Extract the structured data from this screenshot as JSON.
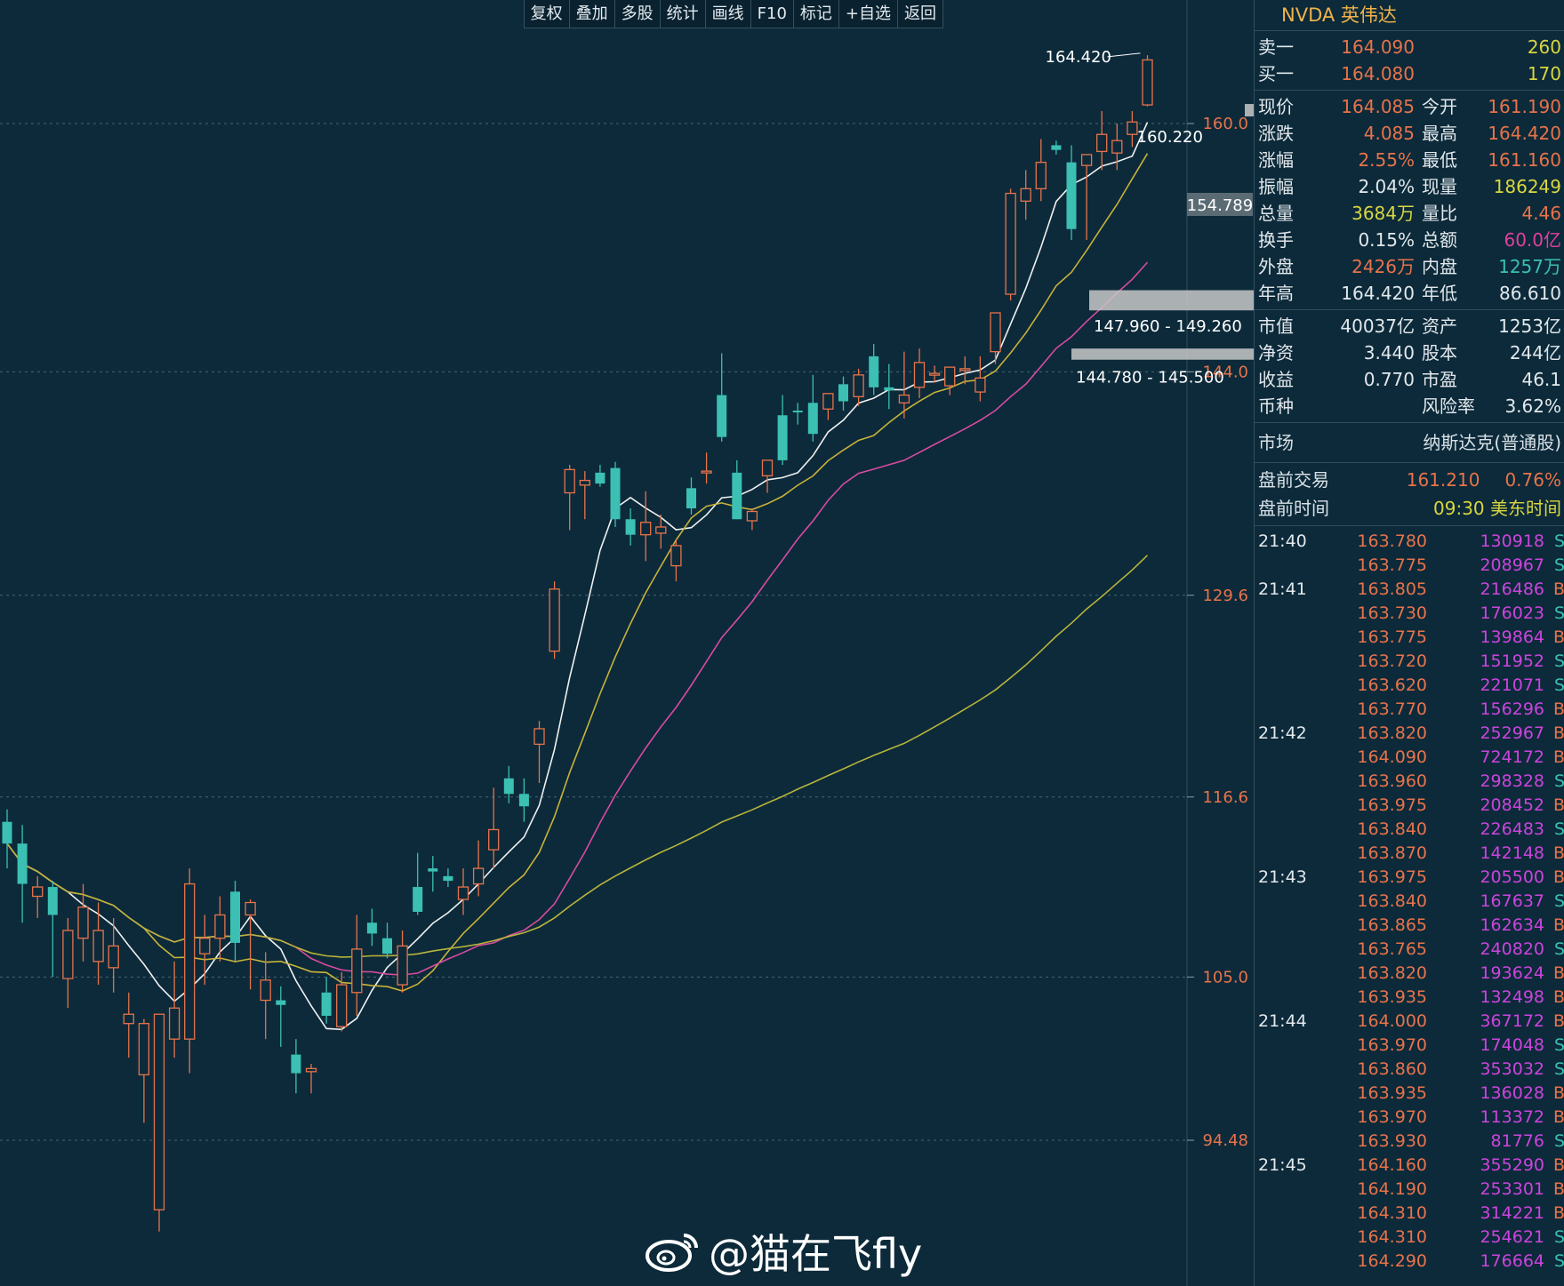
{
  "toolbar": [
    "复权",
    "叠加",
    "多股",
    "统计",
    "画线",
    "F10",
    "标记",
    "+自选",
    "返回"
  ],
  "chart": {
    "price_axis": [
      "160.0",
      "144.0",
      "129.6",
      "116.6",
      "105.0",
      "94.48"
    ],
    "current_tag": "154.789",
    "high_label": "164.420",
    "last_label": "160.220",
    "zone_upper_label": "147.960 - 149.260",
    "zone_lower_label": "144.780 - 145.500"
  },
  "quote": {
    "title": "NVDA 英伟达",
    "book": [
      {
        "label": "卖一",
        "price": "164.090",
        "vol": "260"
      },
      {
        "label": "买一",
        "price": "164.080",
        "vol": "170"
      }
    ],
    "stats": [
      {
        "l1": "现价",
        "v1": "164.085",
        "c1": "red",
        "l2": "今开",
        "v2": "161.190",
        "c2": "red"
      },
      {
        "l1": "涨跌",
        "v1": "4.085",
        "c1": "red",
        "l2": "最高",
        "v2": "164.420",
        "c2": "red"
      },
      {
        "l1": "涨幅",
        "v1": "2.55%",
        "c1": "red",
        "l2": "最低",
        "v2": "161.160",
        "c2": "red"
      },
      {
        "l1": "振幅",
        "v1": "2.04%",
        "c1": "wht",
        "l2": "现量",
        "v2": "186249",
        "c2": "yel"
      },
      {
        "l1": "总量",
        "v1": "3684万",
        "c1": "yel",
        "l2": "量比",
        "v2": "4.46",
        "c2": "red"
      },
      {
        "l1": "换手",
        "v1": "0.15%",
        "c1": "wht",
        "l2": "总额",
        "v2": "60.0亿",
        "c2": "mag"
      },
      {
        "l1": "外盘",
        "v1": "2426万",
        "c1": "red",
        "l2": "内盘",
        "v2": "1257万",
        "c2": "teal"
      },
      {
        "l1": "年高",
        "v1": "164.420",
        "c1": "wht",
        "l2": "年低",
        "v2": "86.610",
        "c2": "wht"
      }
    ],
    "fundamentals": [
      {
        "l1": "市值",
        "v1": "40037亿",
        "l2": "资产",
        "v2": "1253亿"
      },
      {
        "l1": "净资",
        "v1": "3.440",
        "l2": "股本",
        "v2": "244亿"
      },
      {
        "l1": "收益",
        "v1": "0.770",
        "l2": "市盈",
        "v2": "46.1"
      },
      {
        "l1": "币种",
        "v1": "",
        "l2": "风险率",
        "v2": "3.62%"
      }
    ],
    "market_label": "市场",
    "market_value": "纳斯达克(普通股)",
    "premarket_label": "盘前交易",
    "premarket_price": "161.210",
    "premarket_pct": "0.76%",
    "pretime_label": "盘前时间",
    "pretime_value": "09:30 美东时间"
  },
  "ticks": [
    {
      "t": "21:40",
      "p": "163.780",
      "v": "130918",
      "s": "S"
    },
    {
      "t": "",
      "p": "163.775",
      "v": "208967",
      "s": "S"
    },
    {
      "t": "21:41",
      "p": "163.805",
      "v": "216486",
      "s": "B"
    },
    {
      "t": "",
      "p": "163.730",
      "v": "176023",
      "s": "S"
    },
    {
      "t": "",
      "p": "163.775",
      "v": "139864",
      "s": "B"
    },
    {
      "t": "",
      "p": "163.720",
      "v": "151952",
      "s": "S"
    },
    {
      "t": "",
      "p": "163.620",
      "v": "221071",
      "s": "S"
    },
    {
      "t": "",
      "p": "163.770",
      "v": "156296",
      "s": "B"
    },
    {
      "t": "21:42",
      "p": "163.820",
      "v": "252967",
      "s": "B"
    },
    {
      "t": "",
      "p": "164.090",
      "v": "724172",
      "s": "B"
    },
    {
      "t": "",
      "p": "163.960",
      "v": "298328",
      "s": "S"
    },
    {
      "t": "",
      "p": "163.975",
      "v": "208452",
      "s": "B"
    },
    {
      "t": "",
      "p": "163.840",
      "v": "226483",
      "s": "S"
    },
    {
      "t": "",
      "p": "163.870",
      "v": "142148",
      "s": "B"
    },
    {
      "t": "21:43",
      "p": "163.975",
      "v": "205500",
      "s": "B"
    },
    {
      "t": "",
      "p": "163.840",
      "v": "167637",
      "s": "S"
    },
    {
      "t": "",
      "p": "163.865",
      "v": "162634",
      "s": "B"
    },
    {
      "t": "",
      "p": "163.765",
      "v": "240820",
      "s": "S"
    },
    {
      "t": "",
      "p": "163.820",
      "v": "193624",
      "s": "B"
    },
    {
      "t": "",
      "p": "163.935",
      "v": "132498",
      "s": "B"
    },
    {
      "t": "21:44",
      "p": "164.000",
      "v": "367172",
      "s": "B"
    },
    {
      "t": "",
      "p": "163.970",
      "v": "174048",
      "s": "S"
    },
    {
      "t": "",
      "p": "163.860",
      "v": "353032",
      "s": "S"
    },
    {
      "t": "",
      "p": "163.935",
      "v": "136028",
      "s": "B"
    },
    {
      "t": "",
      "p": "163.970",
      "v": "113372",
      "s": "B"
    },
    {
      "t": "",
      "p": "163.930",
      "v": "81776",
      "s": "S"
    },
    {
      "t": "21:45",
      "p": "164.160",
      "v": "355290",
      "s": "B"
    },
    {
      "t": "",
      "p": "164.190",
      "v": "253301",
      "s": "B"
    },
    {
      "t": "",
      "p": "164.310",
      "v": "314221",
      "s": "B"
    },
    {
      "t": "",
      "p": "164.310",
      "v": "254621",
      "s": "S"
    },
    {
      "t": "",
      "p": "164.290",
      "v": "176664",
      "s": "S"
    }
  ],
  "watermark": "@猫在飞fly",
  "colors": {
    "up": "#e8734a",
    "down": "#3bc0b3",
    "bg": "#0c2a3a"
  },
  "chart_data": {
    "type": "candlestick",
    "y_ticks": [
      160.0,
      144.0,
      129.6,
      116.6,
      105.0,
      94.48
    ],
    "candles": [
      [
        115.0,
        115.8,
        112.0,
        113.6
      ],
      [
        113.6,
        114.8,
        108.5,
        111.0
      ],
      [
        110.2,
        111.5,
        108.8,
        110.8
      ],
      [
        110.8,
        111.2,
        105.0,
        109.0
      ],
      [
        104.9,
        108.8,
        103.0,
        108.0
      ],
      [
        107.5,
        111.0,
        106.0,
        109.5
      ],
      [
        106.0,
        109.8,
        104.5,
        108.0
      ],
      [
        105.6,
        108.8,
        104.0,
        107.0
      ],
      [
        102.0,
        104.0,
        99.8,
        102.6
      ],
      [
        98.7,
        102.3,
        95.6,
        102.0
      ],
      [
        90.0,
        102.6,
        88.6,
        102.6
      ],
      [
        101.0,
        106.0,
        99.8,
        103.0
      ],
      [
        101.0,
        112.0,
        98.8,
        111.0
      ],
      [
        106.5,
        109.0,
        104.5,
        107.5
      ],
      [
        107.5,
        110.2,
        106.0,
        109.0
      ],
      [
        110.5,
        111.2,
        106.0,
        107.2
      ],
      [
        109.0,
        110.0,
        104.2,
        109.8
      ],
      [
        103.5,
        106.6,
        101.0,
        104.8
      ],
      [
        103.5,
        104.4,
        100.5,
        103.2
      ],
      [
        100.0,
        101.0,
        97.5,
        98.8
      ],
      [
        98.9,
        99.4,
        97.5,
        99.1
      ],
      [
        104.0,
        105.0,
        102.0,
        102.5
      ],
      [
        101.8,
        105.3,
        101.5,
        104.5
      ],
      [
        104.0,
        109.0,
        102.5,
        106.8
      ],
      [
        108.5,
        109.4,
        107.0,
        107.8
      ],
      [
        107.5,
        108.5,
        106.2,
        106.5
      ],
      [
        104.5,
        108.0,
        104.0,
        107.0
      ],
      [
        110.8,
        113.0,
        109.0,
        109.2
      ],
      [
        112.0,
        112.8,
        110.5,
        111.8
      ],
      [
        111.5,
        112.0,
        110.8,
        111.2
      ],
      [
        110.0,
        112.0,
        109.0,
        110.8
      ],
      [
        111.0,
        113.8,
        110.2,
        112.0
      ],
      [
        113.2,
        117.2,
        112.0,
        114.5
      ],
      [
        117.8,
        118.6,
        116.2,
        116.8
      ],
      [
        116.8,
        117.8,
        115.0,
        116.0
      ],
      [
        120.0,
        121.5,
        117.5,
        121.0
      ],
      [
        126.0,
        130.5,
        125.5,
        130.0
      ],
      [
        136.2,
        138.0,
        133.8,
        137.7
      ],
      [
        136.7,
        137.6,
        134.5,
        137.0
      ],
      [
        137.5,
        138.0,
        136.6,
        136.8
      ],
      [
        137.8,
        138.2,
        134.0,
        134.5
      ],
      [
        134.5,
        135.2,
        132.8,
        133.5
      ],
      [
        133.5,
        136.3,
        131.8,
        134.3
      ],
      [
        133.6,
        134.8,
        132.6,
        134.0
      ],
      [
        131.5,
        133.2,
        130.5,
        132.8
      ],
      [
        136.5,
        137.2,
        134.8,
        135.2
      ],
      [
        137.5,
        138.8,
        136.8,
        137.6
      ],
      [
        142.5,
        145.2,
        139.5,
        139.8
      ],
      [
        137.5,
        138.3,
        134.5,
        134.5
      ],
      [
        134.4,
        135.2,
        133.8,
        135.0
      ],
      [
        137.3,
        138.3,
        136.2,
        138.3
      ],
      [
        141.2,
        142.5,
        138.0,
        138.3
      ],
      [
        141.5,
        142.0,
        140.6,
        141.4
      ],
      [
        142.0,
        143.8,
        139.5,
        140.0
      ],
      [
        141.6,
        142.5,
        140.9,
        142.6
      ],
      [
        143.2,
        143.7,
        141.5,
        142.1
      ],
      [
        142.4,
        144.2,
        141.8,
        143.8
      ],
      [
        145.0,
        145.8,
        142.5,
        143.0
      ],
      [
        143.0,
        144.5,
        141.6,
        142.8
      ],
      [
        142.0,
        145.3,
        141.0,
        142.5
      ],
      [
        143.0,
        145.5,
        142.3,
        144.6
      ],
      [
        143.8,
        144.4,
        143.3,
        143.9
      ],
      [
        143.1,
        144.1,
        142.5,
        144.3
      ],
      [
        144.1,
        145.0,
        143.2,
        144.2
      ],
      [
        142.7,
        145.0,
        142.1,
        143.6
      ],
      [
        145.3,
        147.5,
        144.5,
        147.8
      ],
      [
        149.0,
        155.8,
        148.6,
        155.5
      ],
      [
        155.0,
        157.0,
        153.8,
        155.8
      ],
      [
        155.8,
        159.0,
        155.0,
        157.5
      ],
      [
        158.6,
        158.9,
        158.0,
        158.3
      ],
      [
        157.5,
        158.6,
        152.5,
        153.2
      ],
      [
        157.3,
        157.9,
        152.5,
        158.0
      ],
      [
        158.2,
        160.8,
        157.0,
        159.3
      ],
      [
        158.1,
        160.0,
        157.0,
        158.9
      ],
      [
        159.3,
        160.8,
        158.5,
        160.1
      ],
      [
        161.2,
        164.4,
        161.1,
        164.1
      ]
    ],
    "ma_lines": [
      "white",
      "yellow",
      "magenta",
      "olive"
    ]
  }
}
